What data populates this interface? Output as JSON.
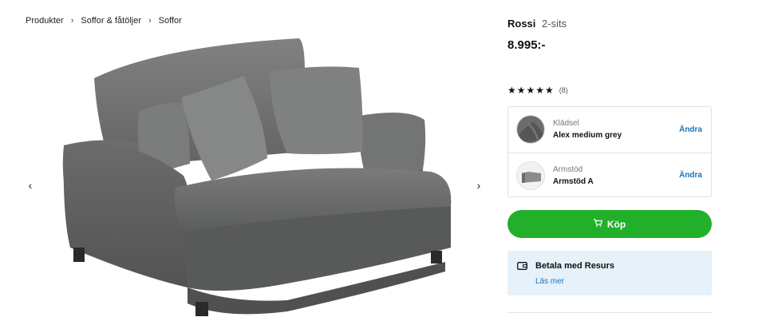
{
  "breadcrumb": {
    "items": [
      "Produkter",
      "Soffor & fåtöljer",
      "Soffor"
    ],
    "separator": "›"
  },
  "gallery": {
    "prev_icon": "‹",
    "next_icon": "›",
    "image_subject": "grey 2-seat sofa with cushions"
  },
  "product": {
    "name": "Rossi",
    "variant": "2-sits",
    "price": "8.995:-",
    "rating": {
      "value": 4.5,
      "max": 5,
      "stars": "★★★★★",
      "count_label": "(8)"
    }
  },
  "options": [
    {
      "label": "Klädsel",
      "value": "Alex medium grey",
      "change_label": "Ändra"
    },
    {
      "label": "Armstöd",
      "value": "Armstöd A",
      "change_label": "Ändra"
    }
  ],
  "buy": {
    "label": "Köp",
    "icon": "cart-icon"
  },
  "payment": {
    "title": "Betala med Resurs",
    "link": "Läs mer",
    "icon": "wallet-icon"
  },
  "colors": {
    "buy_green": "#22b02a",
    "link_blue": "#1b75b8",
    "payment_bg": "#e6f1f9",
    "sofa_grey": "#6e6f6f"
  }
}
